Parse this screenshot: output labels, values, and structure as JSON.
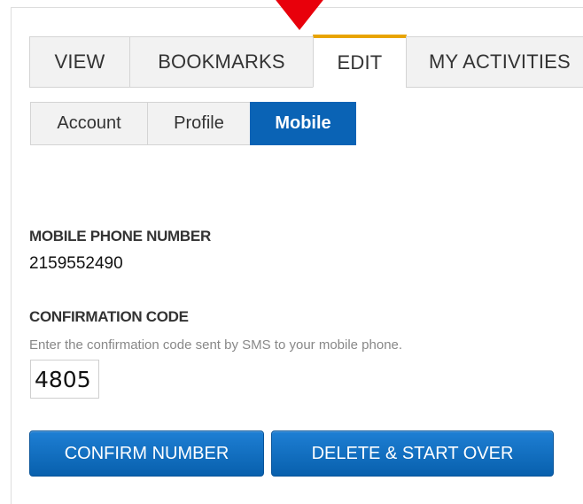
{
  "tabs": [
    {
      "label": "VIEW"
    },
    {
      "label": "BOOKMARKS"
    },
    {
      "label": "EDIT",
      "active": true
    },
    {
      "label": "MY ACTIVITIES"
    }
  ],
  "subtabs": [
    {
      "label": "Account"
    },
    {
      "label": "Profile"
    },
    {
      "label": "Mobile",
      "active": true
    }
  ],
  "mobile": {
    "phone_label": "MOBILE PHONE NUMBER",
    "phone_value": "2159552490",
    "code_label": "CONFIRMATION CODE",
    "code_hint": "Enter the confirmation code sent by SMS to your mobile phone.",
    "code_value": "4805"
  },
  "buttons": {
    "confirm": "CONFIRM NUMBER",
    "delete": "DELETE & START OVER"
  },
  "colors": {
    "accent_blue": "#0a63b5",
    "active_tab_border": "#e8a400",
    "marker_red": "#e8000b"
  },
  "icons": {
    "marker": "pointer-triangle-icon"
  }
}
